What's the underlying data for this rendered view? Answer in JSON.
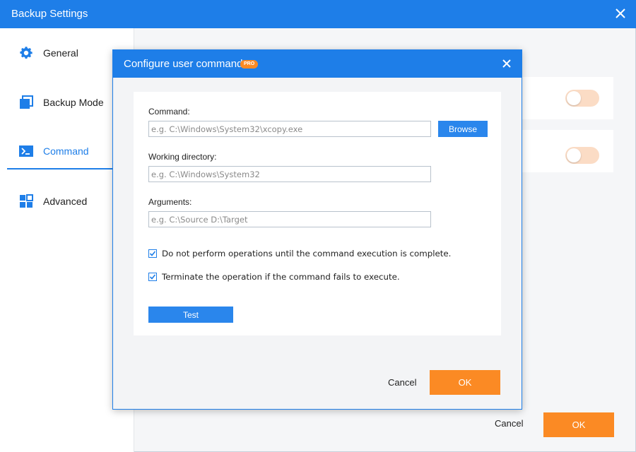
{
  "window": {
    "title": "Backup Settings",
    "close_icon": "close-icon"
  },
  "sidebar": {
    "items": [
      {
        "label": "General",
        "icon": "gear-icon",
        "active": false
      },
      {
        "label": "Backup Mode",
        "icon": "backup-mode-icon",
        "active": false
      },
      {
        "label": "Command",
        "icon": "terminal-icon",
        "active": true
      },
      {
        "label": "Advanced",
        "icon": "grid-icon",
        "active": false
      }
    ]
  },
  "main": {
    "toggles": [
      {
        "state": "off"
      },
      {
        "state": "off"
      }
    ]
  },
  "footer": {
    "cancel_label": "Cancel",
    "ok_label": "OK"
  },
  "dialog": {
    "title": "Configure user command",
    "badge": "PRO",
    "command": {
      "label": "Command:",
      "placeholder": "e.g. C:\\Windows\\System32\\xcopy.exe",
      "value": "",
      "browse_label": "Browse"
    },
    "working_directory": {
      "label": "Working directory:",
      "placeholder": "e.g. C:\\Windows\\System32",
      "value": ""
    },
    "arguments": {
      "label": "Arguments:",
      "placeholder": "e.g. C:\\Source D:\\Target",
      "value": ""
    },
    "options": [
      {
        "label": "Do not perform operations until the command execution is complete.",
        "checked": true
      },
      {
        "label": "Terminate the operation if the command fails to execute.",
        "checked": true
      }
    ],
    "test_label": "Test",
    "cancel_label": "Cancel",
    "ok_label": "OK"
  },
  "colors": {
    "accent": "#1e7ee8",
    "button_blue": "#2a86ec",
    "ok_orange": "#fb8a24",
    "toggle_off": "#fbdcc5"
  }
}
